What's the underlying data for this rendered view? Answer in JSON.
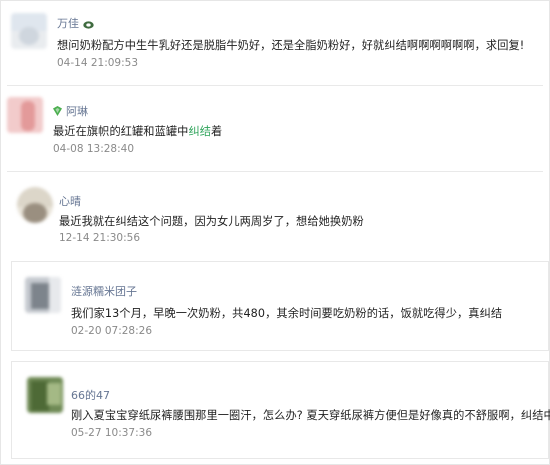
{
  "comments": [
    {
      "name": "万佳",
      "content": "想问奶粉配方中生牛乳好还是脱脂牛奶好，还是全脂奶粉好，好就纠结啊啊啊啊啊啊，求回复!",
      "time": "04-14 21:09:53",
      "name_icon": "vip-icon"
    },
    {
      "name": "阿琳",
      "content_before": "最近在旗帜的红罐和蓝罐中",
      "content_highlight": "纠结",
      "content_after": "着",
      "time": "04-08 13:28:40",
      "name_icon": "badge-icon"
    },
    {
      "name": "心晴",
      "content": "最近我就在纠结这个问题，因为女儿两周岁了，想给她换奶粉",
      "time": "12-14 21:30:56"
    },
    {
      "name": "涟源糯米团子",
      "content": "我们家13个月，早晚一次奶粉，共480，其余时间要吃奶粉的话，饭就吃得少，真纠结",
      "time": "02-20 07:28:26"
    },
    {
      "name": "66的47",
      "content": "刚入夏宝宝穿纸尿裤腰围那里一圈汗，怎么办? 夏天穿纸尿裤方便但是好像真的不舒服啊，纠结中",
      "time": "05-27 10:37:36"
    }
  ],
  "colors": {
    "name": "#667693",
    "highlight": "#2ea35a",
    "time": "#8a8a8a",
    "text": "#1f1f1f"
  }
}
